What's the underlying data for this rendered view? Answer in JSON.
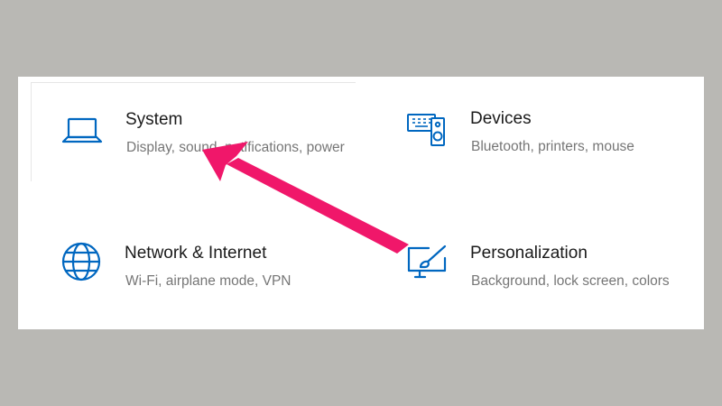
{
  "settings": {
    "accent_color": "#0067c0",
    "tiles": [
      {
        "icon": "laptop-icon",
        "title": "System",
        "description": "Display, sound, notifications, power"
      },
      {
        "icon": "devices-icon",
        "title": "Devices",
        "description": "Bluetooth, printers, mouse"
      },
      {
        "icon": "globe-icon",
        "title": "Network & Internet",
        "description": "Wi-Fi, airplane mode, VPN"
      },
      {
        "icon": "personalization-icon",
        "title": "Personalization",
        "description": "Background, lock screen, colors"
      }
    ]
  },
  "annotation": {
    "type": "arrow",
    "color": "#f0176a",
    "points_to": "System"
  }
}
